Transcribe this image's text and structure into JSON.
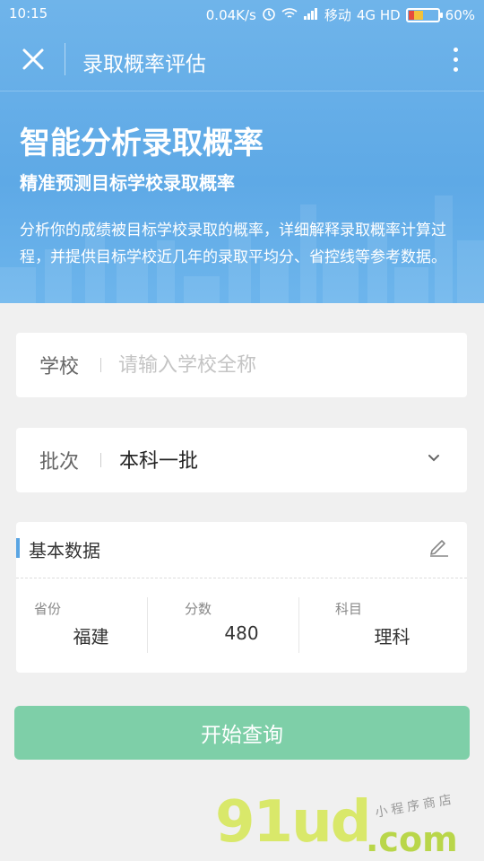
{
  "status": {
    "time": "10:15",
    "speed": "0.04K/s",
    "carrier": "移动",
    "network": "4G HD",
    "battery": "60%"
  },
  "nav": {
    "title": "录取概率评估",
    "close_icon": "close-icon",
    "more_icon": "more-vertical-icon"
  },
  "hero": {
    "title": "智能分析录取概率",
    "subtitle": "精准预测目标学校录取概率",
    "description": "分析你的成绩被目标学校录取的概率，详细解释录取概率计算过程，并提供目标学校近几年的录取平均分、省控线等参考数据。"
  },
  "form": {
    "school_label": "学校",
    "school_placeholder": "请输入学校全称",
    "school_value": "",
    "batch_label": "批次",
    "batch_value": "本科一批"
  },
  "basic": {
    "title": "基本数据",
    "province_label": "省份",
    "province_value": "福建",
    "score_label": "分数",
    "score_value": "480",
    "subject_label": "科目",
    "subject_value": "理科"
  },
  "action": {
    "query_label": "开始查询"
  },
  "watermark": {
    "brand": "91ud",
    "domain": ".com",
    "tagline": "小程序商店"
  },
  "colors": {
    "primary": "#5ea9e6",
    "button": "#7ecfa8",
    "accent": "#5aa5e3"
  }
}
